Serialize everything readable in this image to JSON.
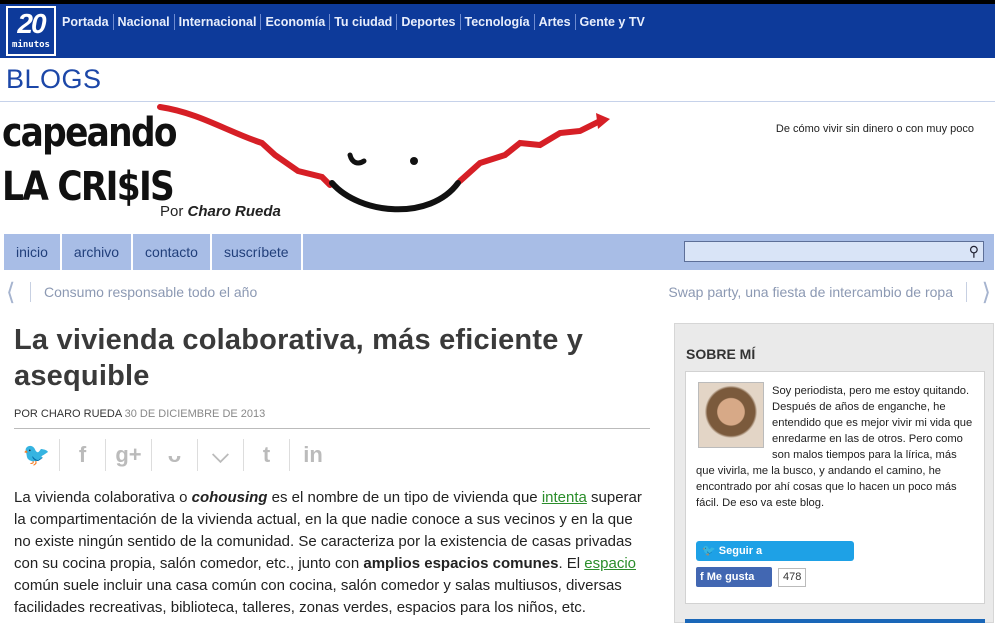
{
  "topnav": {
    "logo_number": "20",
    "logo_word": "minutos",
    "links": [
      "Portada",
      "Nacional",
      "Internacional",
      "Economía",
      "Tu ciudad",
      "Deportes",
      "Tecnología",
      "Artes",
      "Gente y TV"
    ]
  },
  "blogs_label": "BLOGS",
  "banner": {
    "logo_line1": "capeando",
    "logo_line2": "LA CRI$IS",
    "byline_prefix": "Por",
    "byline_author": "Charo Rueda",
    "tagline": "De cómo vivir sin dinero o con muy poco"
  },
  "blog_menu": [
    "inicio",
    "archivo",
    "contacto",
    "suscríbete"
  ],
  "search": {
    "placeholder": ""
  },
  "post_nav": {
    "prev": "Consumo responsable todo el año",
    "next": "Swap party, una fiesta de intercambio de ropa"
  },
  "post": {
    "title": "La vivienda colaborativa, más eficiente y asequible",
    "author": "POR CHARO RUEDA",
    "date": "30 DE DICIEMBRE DE 2013",
    "share_icons": [
      "twitter-icon",
      "facebook-icon",
      "googleplus-icon",
      "meneame-icon",
      "pocket-icon",
      "tumblr-icon",
      "linkedin-icon"
    ],
    "body": {
      "p1_a": "La vivienda colaborativa o ",
      "p1_em": "cohousing",
      "p1_b": " es el nombre de un tipo de vivienda que ",
      "p1_link1": "intenta",
      "p1_c": " superar la  compartimentación de la vivienda actual, en la que nadie conoce a sus vecinos y en la que no existe ningún sentido de la comunidad. Se caracteriza por la existencia de casas privadas con su cocina propia, salón comedor, etc., junto con ",
      "p1_strong": "amplios espacios comunes",
      "p1_d": ". El ",
      "p1_link2": "espacio",
      "p1_e": " común suele incluir una casa común con cocina, salón comedor y salas multiusos, diversas facilidades recreativas, biblioteca, talleres, zonas verdes, espacios para los niños, etc."
    }
  },
  "sidebar": {
    "title": "SOBRE MÍ",
    "bio": "Soy periodista, pero me estoy quitando. Después de años de enganche, he entendido que es mejor vivir mi vida que enredarme en las de otros. Pero como son malos tiempos para la lírica, más que vivirla, me la busco, y andando el camino, he encontrado por ahí cosas que lo hacen un poco más fácil. De eso va este blog.",
    "twitter_button": "Seguir a @Chapiescarlata",
    "facebook_button": "Me gusta",
    "facebook_count": "478"
  }
}
